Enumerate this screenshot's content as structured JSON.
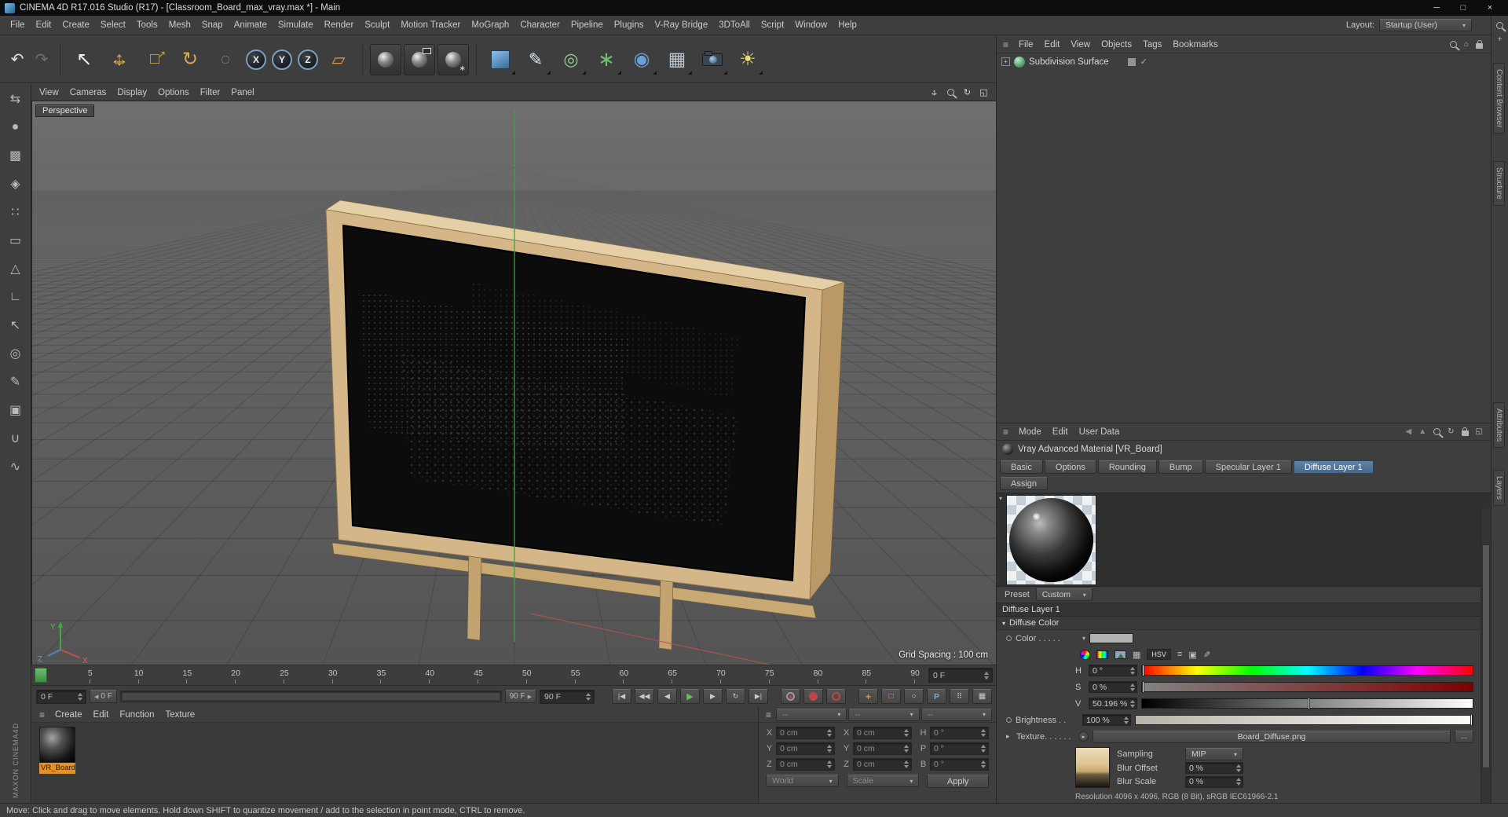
{
  "title_bar": {
    "title": "CINEMA 4D R17.016 Studio (R17) - [Classroom_Board_max_vray.max *] - Main",
    "minimize": "─",
    "maximize": "□",
    "close": "×"
  },
  "menu_bar": {
    "items": [
      "File",
      "Edit",
      "Create",
      "Select",
      "Tools",
      "Mesh",
      "Snap",
      "Animate",
      "Simulate",
      "Render",
      "Sculpt",
      "Motion Tracker",
      "MoGraph",
      "Character",
      "Pipeline",
      "Plugins",
      "V-Ray Bridge",
      "3DToAll",
      "Script",
      "Window",
      "Help"
    ],
    "layout_label": "Layout:",
    "layout_value": "Startup (User)"
  },
  "viewport": {
    "menus": [
      "View",
      "Cameras",
      "Display",
      "Options",
      "Filter",
      "Panel"
    ],
    "view_label": "Perspective",
    "grid_spacing": "Grid Spacing : 100 cm",
    "axis_x": "X",
    "axis_y": "Y",
    "axis_z": "Z"
  },
  "timeline": {
    "ticks": [
      "5",
      "10",
      "15",
      "20",
      "25",
      "30",
      "35",
      "40",
      "45",
      "50",
      "55",
      "60",
      "65",
      "70",
      "75",
      "80",
      "85",
      "90"
    ],
    "current_field": "0 F",
    "start_field": "0 F",
    "range_start": "0 F",
    "range_end": "90 F",
    "end_field": "90 F"
  },
  "materials_panel": {
    "menus": [
      "Create",
      "Edit",
      "Function",
      "Texture"
    ],
    "material_name": "VR_Board"
  },
  "coordinates_panel": {
    "headers": [
      "--",
      "--",
      "--"
    ],
    "position": {
      "x_label": "X",
      "y_label": "Y",
      "z_label": "Z",
      "x": "0 cm",
      "y": "0 cm",
      "z": "0 cm"
    },
    "size": {
      "x_label": "X",
      "y_label": "Y",
      "z_label": "Z",
      "x": "0 cm",
      "y": "0 cm",
      "z": "0 cm"
    },
    "rotation": {
      "h_label": "H",
      "p_label": "P",
      "b_label": "B",
      "h": "0 °",
      "p": "0 °",
      "b": "0 °"
    },
    "world": "World",
    "scale": "Scale",
    "apply": "Apply"
  },
  "object_manager": {
    "menus": [
      "File",
      "Edit",
      "View",
      "Objects",
      "Tags",
      "Bookmarks"
    ],
    "object_name": "Subdivision Surface"
  },
  "attribute_manager": {
    "menus": [
      "Mode",
      "Edit",
      "User Data"
    ],
    "material_title": "Vray Advanced Material [VR_Board]",
    "tabs": [
      "Basic",
      "Options",
      "Rounding",
      "Bump",
      "Specular Layer 1",
      "Diffuse Layer 1"
    ],
    "assign_tab": "Assign",
    "preset_label": "Preset",
    "preset_value": "Custom",
    "section": "Diffuse Layer 1",
    "subsection": "Diffuse Color",
    "color_label": "Color . . . . .",
    "hsv_chip": "HSV",
    "h_label": "H",
    "h_value": "0 °",
    "s_label": "S",
    "s_value": "0 %",
    "v_label": "V",
    "v_value": "50.196 %",
    "brightness_label": "Brightness . .",
    "brightness_value": "100 %",
    "texture_label": "Texture. . . . . .",
    "texture_file": "Board_Diffuse.png",
    "more_button": "...",
    "sampling_label": "Sampling",
    "sampling_value": "MIP",
    "blur_offset_label": "Blur Offset",
    "blur_offset_value": "0 %",
    "blur_scale_label": "Blur Scale",
    "blur_scale_value": "0 %",
    "resolution": "Resolution 4096 x 4096, RGB (8 Bit), sRGB IEC61966-2.1"
  },
  "right_dock": {
    "tabs": [
      "Content Browser",
      "Structure",
      "Attributes",
      "Layers"
    ]
  },
  "status_bar": {
    "text": "Move: Click and drag to move elements. Hold down SHIFT to quantize movement / add to the selection in point mode, CTRL to remove."
  },
  "branding": {
    "vertical_logo": "MAXON CINEMA4D"
  },
  "icons": {
    "hamburger": "≡",
    "dropdown": "▾",
    "expander_down": "▾",
    "expander_right": "▸",
    "undo": "↶",
    "redo": "↷",
    "selection": "↖",
    "move_h": "↔",
    "move_v": "↕",
    "scale_box": "□",
    "scale_arrow": "↗",
    "rotate": "↻",
    "last_tool": "◌",
    "axis_x": "X",
    "axis_y": "Y",
    "axis_z": "Z",
    "workplane": "▱",
    "pen": "✎",
    "subdivision": "◎",
    "mograph": "∗",
    "deformer": "◉",
    "floor": "▦",
    "light": "☀",
    "gear": "∗",
    "nav_rotate": "↻",
    "nav_toggle": "◱",
    "goto_start": "|◀",
    "prev_key": "◀◀",
    "prev_frame": "◀",
    "play": "▶",
    "next_frame": "▶",
    "next_key": "▶▶",
    "goto_end": "▶|",
    "loop": "↻",
    "key_position": "+",
    "key_scale": "□",
    "key_rotation": "○",
    "key_parameter": "P",
    "key_pla": "⠿",
    "key_solo": "▦",
    "back": "◀",
    "up": "▲",
    "home": "⌂",
    "plus": "+",
    "swatches": "▦",
    "sliders": "≡",
    "compact": "▣",
    "eyedropper": "✎",
    "check": "✓",
    "left_tools": [
      "⇆",
      "●",
      "▩",
      "◈",
      "∷",
      "▭",
      "△",
      "∟",
      "↖",
      "◎",
      "✎",
      "▣",
      "∪",
      "∿"
    ]
  }
}
